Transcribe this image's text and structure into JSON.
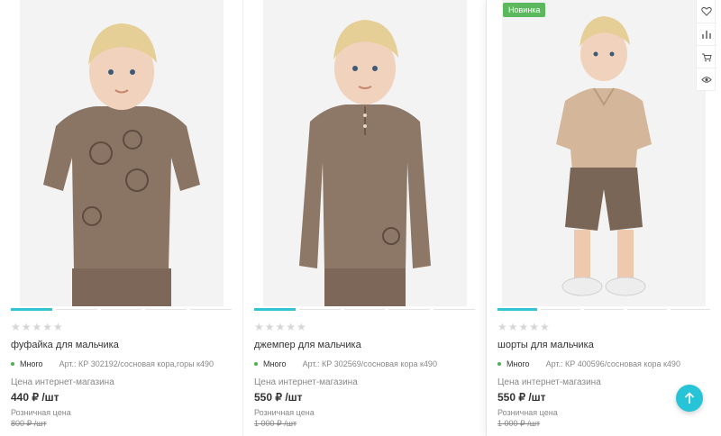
{
  "products": [
    {
      "title": "фуфайка для мальчика",
      "stock": "Много",
      "art": "Арт.: КР 302192/сосновая кора,горы к490",
      "price_label": "Цена интернет-магазина",
      "price": "440 ₽ /шт",
      "retail_label": "Розничная цена",
      "retail_price": "800 ₽ /шт",
      "rating": 0,
      "stars": "★★★★★"
    },
    {
      "title": "джемпер для мальчика",
      "stock": "Много",
      "art": "Арт.: КР 302569/сосновая кора к490",
      "price_label": "Цена интернет-магазина",
      "price": "550 ₽ /шт",
      "retail_label": "Розничная цена",
      "retail_price": "1 000 ₽ /шт",
      "rating": 0,
      "stars": "★★★★★"
    },
    {
      "title": "шорты для мальчика",
      "badge": "Новинка",
      "stock": "Много",
      "art": "Арт.: КР 400596/сосновая кора к490",
      "price_label": "Цена интернет-магазина",
      "price": "550 ₽ /шт",
      "retail_label": "Розничная цена",
      "retail_price": "1 000 ₽ /шт",
      "rating": 0,
      "stars": "★★★★★"
    }
  ],
  "actions": [
    "heart-icon",
    "compare-icon",
    "cart-icon",
    "eye-icon"
  ],
  "colors": {
    "accent": "#27c3d6",
    "badge": "#5cb85c",
    "in_stock": "#4caf50"
  }
}
